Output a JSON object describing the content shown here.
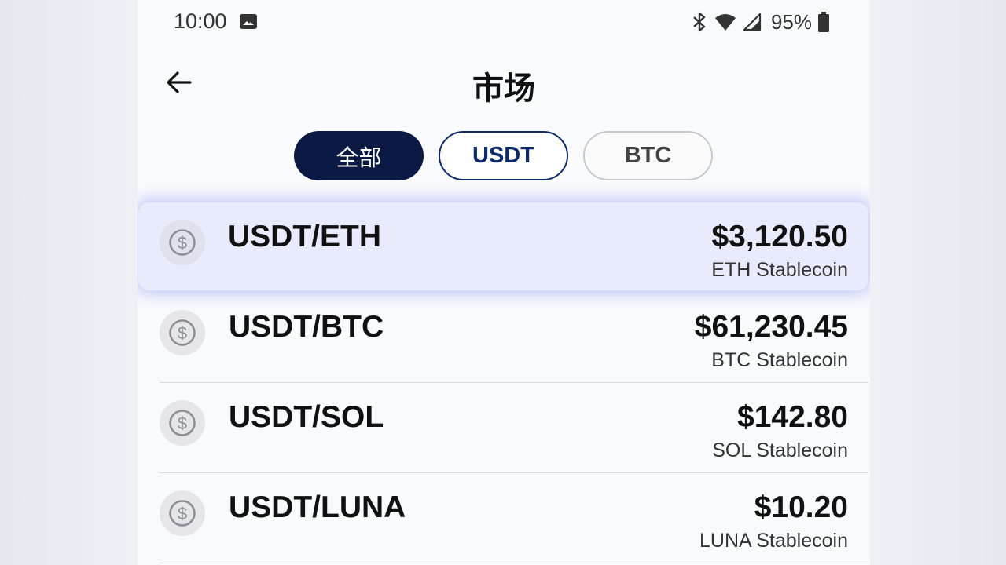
{
  "status_bar": {
    "time": "10:00",
    "battery": "95%",
    "icons": [
      "gallery-icon",
      "bluetooth-icon",
      "wifi-icon",
      "signal-icon",
      "battery-icon"
    ]
  },
  "header": {
    "title": "市场",
    "back_icon": "arrow-left-icon"
  },
  "tabs": [
    {
      "label": "全部",
      "state": "selected"
    },
    {
      "label": "USDT",
      "state": "outlined"
    },
    {
      "label": "BTC",
      "state": "default"
    }
  ],
  "markets": [
    {
      "pair": "USDT/ETH",
      "price": "$3,120.50",
      "subtitle": "ETH Stablecoin",
      "highlighted": true
    },
    {
      "pair": "USDT/BTC",
      "price": "$61,230.45",
      "subtitle": "BTC Stablecoin"
    },
    {
      "pair": "USDT/SOL",
      "price": "$142.80",
      "subtitle": "SOL Stablecoin"
    },
    {
      "pair": "USDT/LUNA",
      "price": "$10.20",
      "subtitle": "LUNA Stablecoin"
    }
  ],
  "colors": {
    "accent_dark": "#0b1a45",
    "accent_outline": "#0d2a6b",
    "highlight_bg": "#e8ebfb"
  }
}
